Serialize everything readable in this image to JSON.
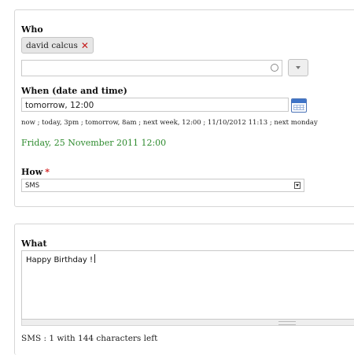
{
  "who": {
    "label": "Who",
    "tags": [
      "david calcus"
    ],
    "remove_symbol": "✕",
    "input_value": "",
    "icons": [
      "loading-circle-icon",
      "chevron-down-icon"
    ]
  },
  "when": {
    "label": "When (date and time)",
    "input_value": "tomorrow, 12:00",
    "hints": "now ; today, 3pm ; tomorrow, 8am ; next week, 12:00 ; 11/10/2012 11:13 ; next monday",
    "parsed": "Friday, 25 November 2011 12:00",
    "icon": "calendar-icon"
  },
  "how": {
    "label": "How",
    "required_marker": "*",
    "selected": "SMS",
    "required_color": "#d21c1c"
  },
  "what": {
    "label": "What",
    "text": "Happy Birthday !",
    "counter": "SMS : 1 with 144 characters left"
  },
  "colors": {
    "parsed_date": "#2e8b2e",
    "remove": "#c51b1b"
  }
}
